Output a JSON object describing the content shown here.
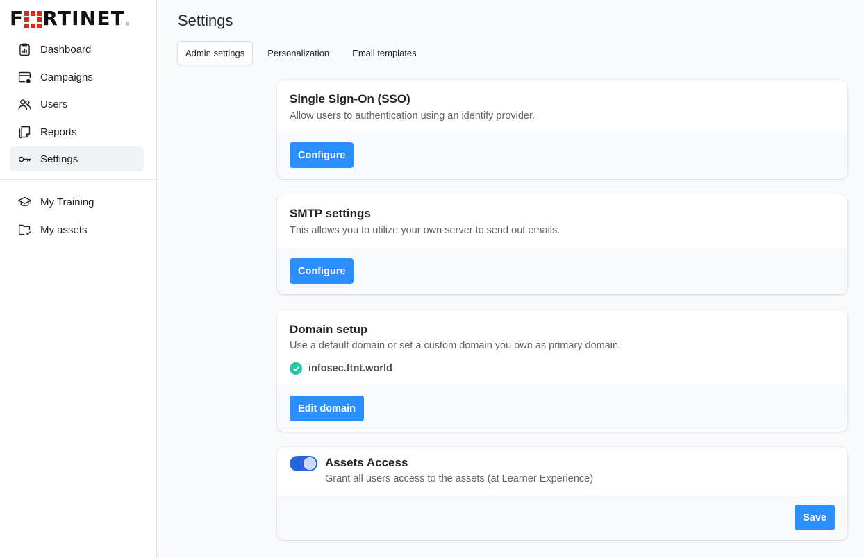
{
  "brand": {
    "logo_text_left": "F",
    "logo_text_right": "RTINET",
    "reg_mark": "®",
    "accent": "#da291c"
  },
  "sidebar": {
    "items": [
      {
        "label": "Dashboard",
        "icon": "clipboard-chart-icon"
      },
      {
        "label": "Campaigns",
        "icon": "browser-window-gear-icon"
      },
      {
        "label": "Users",
        "icon": "users-icon"
      },
      {
        "label": "Reports",
        "icon": "document-stack-icon"
      },
      {
        "label": "Settings",
        "icon": "key-icon",
        "active": true
      },
      {
        "label": "My Training",
        "icon": "graduation-cap-icon"
      },
      {
        "label": "My assets",
        "icon": "folder-check-icon"
      }
    ]
  },
  "page": {
    "title": "Settings",
    "tabs": [
      {
        "label": "Admin settings",
        "active": true
      },
      {
        "label": "Personalization"
      },
      {
        "label": "Email templates"
      }
    ]
  },
  "cards": {
    "sso": {
      "title": "Single Sign-On (SSO)",
      "description": "Allow users to authentication using an identify provider.",
      "button": "Configure"
    },
    "smtp": {
      "title": "SMTP settings",
      "description": "This allows you to utilize your own server to send out emails.",
      "button": "Configure"
    },
    "domain": {
      "title": "Domain setup",
      "description": "Use a default domain or set a custom domain you own as primary domain.",
      "domain_value": "infosec.ftnt.world",
      "status_icon": "check-circle-icon",
      "button": "Edit domain"
    },
    "assets": {
      "title": "Assets Access",
      "description": "Grant all users access to the assets (at Learner Experience)",
      "toggle_on": true,
      "button": "Save"
    }
  },
  "colors": {
    "primary_button": "#2b8fff",
    "toggle_on": "#2565d8",
    "success": "#2bc4a6"
  }
}
